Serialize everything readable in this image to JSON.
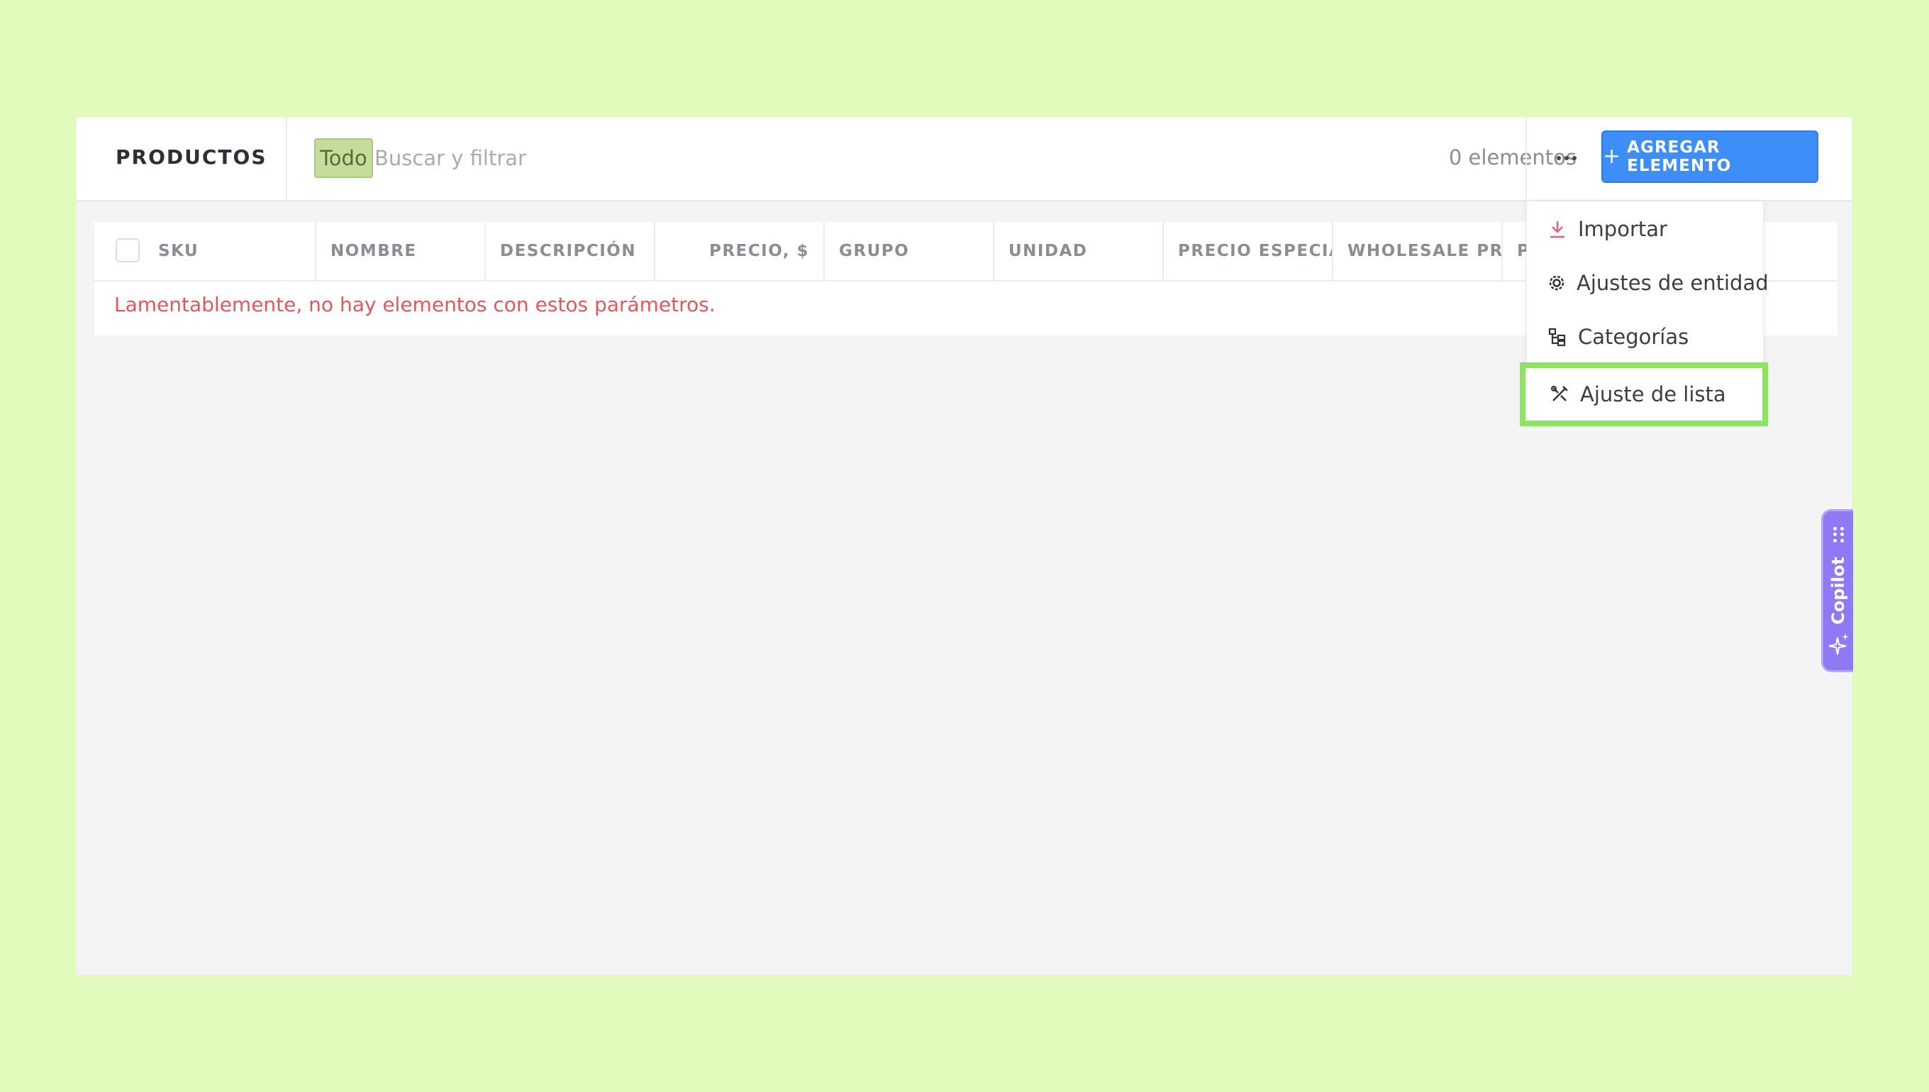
{
  "header": {
    "title": "PRODUCTOS",
    "filter_chip": "Todo",
    "search_placeholder": "Buscar y filtrar",
    "count": "0 elementos",
    "add_button": "AGREGAR ELEMENTO",
    "add_button_prefix": "+"
  },
  "table": {
    "columns": [
      "SKU",
      "NOMBRE",
      "DESCRIPCIÓN",
      "PRECIO, $",
      "GRUPO",
      "UNIDAD",
      "PRECIO ESPECIAL",
      "WHOLESALE PRICE",
      "P"
    ],
    "empty_message": "Lamentablemente, no hay elementos con estos parámetros."
  },
  "menu": {
    "items": [
      {
        "label": "Importar",
        "icon": "download-icon"
      },
      {
        "label": "Ajustes de entidad",
        "icon": "gear-icon"
      },
      {
        "label": "Categorías",
        "icon": "tree-icon"
      },
      {
        "label": "Ajuste de lista",
        "icon": "tools-icon"
      }
    ]
  },
  "copilot": {
    "label": "Copilot"
  },
  "colors": {
    "background": "#e0fbbc",
    "accent": "#3d8ef8",
    "highlight": "#8de462",
    "error_text": "#e2585a",
    "copilot": "#8f79f4"
  }
}
